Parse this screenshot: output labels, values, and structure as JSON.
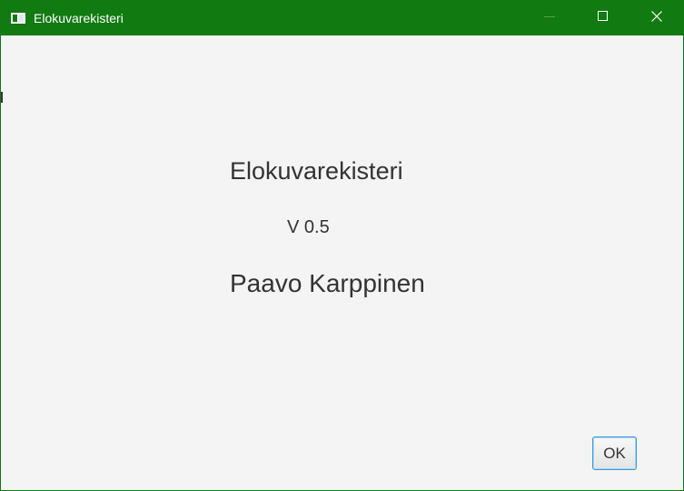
{
  "window": {
    "title": "Elokuvarekisteri",
    "accent_color": "#117a11",
    "controls": {
      "minimize_icon": "minimize-icon",
      "maximize_icon": "maximize-icon",
      "close_icon": "close-icon"
    }
  },
  "about": {
    "app_name": "Elokuvarekisteri",
    "version": "V 0.5",
    "author": "Paavo Karppinen"
  },
  "actions": {
    "ok_label": "OK"
  }
}
